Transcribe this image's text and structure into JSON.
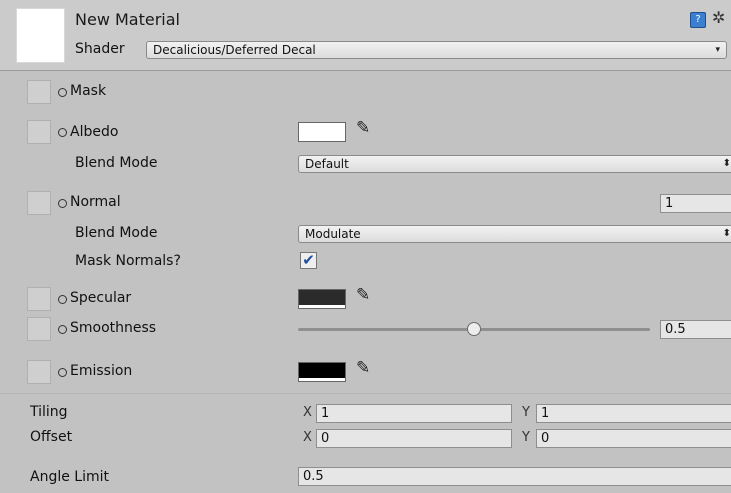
{
  "material": {
    "name": "New Material",
    "shader_label": "Shader",
    "shader_value": "Decalicious/Deferred Decal"
  },
  "header_icons": {
    "help": "book-help-icon",
    "settings": "gear-icon"
  },
  "properties": {
    "mask": {
      "label": "Mask"
    },
    "albedo": {
      "label": "Albedo",
      "color": "#ffffff",
      "blend_label": "Blend Mode",
      "blend_value": "Default"
    },
    "normal": {
      "label": "Normal",
      "scale": "1",
      "blend_label": "Blend Mode",
      "blend_value": "Modulate",
      "mask_normals_label": "Mask Normals?",
      "mask_normals_checked": true
    },
    "specular": {
      "label": "Specular",
      "color": "#2b2b2b"
    },
    "smoothness": {
      "label": "Smoothness",
      "value": "0.5",
      "fraction": 0.5
    },
    "emission": {
      "label": "Emission",
      "color": "#000000"
    }
  },
  "tiling": {
    "label": "Tiling",
    "x_axis": "X",
    "x": "1",
    "y_axis": "Y",
    "y": "1"
  },
  "offset": {
    "label": "Offset",
    "x_axis": "X",
    "x": "0",
    "y_axis": "Y",
    "y": "0"
  },
  "angle_limit": {
    "label": "Angle Limit",
    "value": "0.5"
  },
  "glyphs": {
    "dropdown_arrow_small": "▾",
    "dropdown_arrow_updown": "⬍",
    "checkmark": "✔",
    "picker": "✎",
    "gear": "✲",
    "help": "?"
  }
}
